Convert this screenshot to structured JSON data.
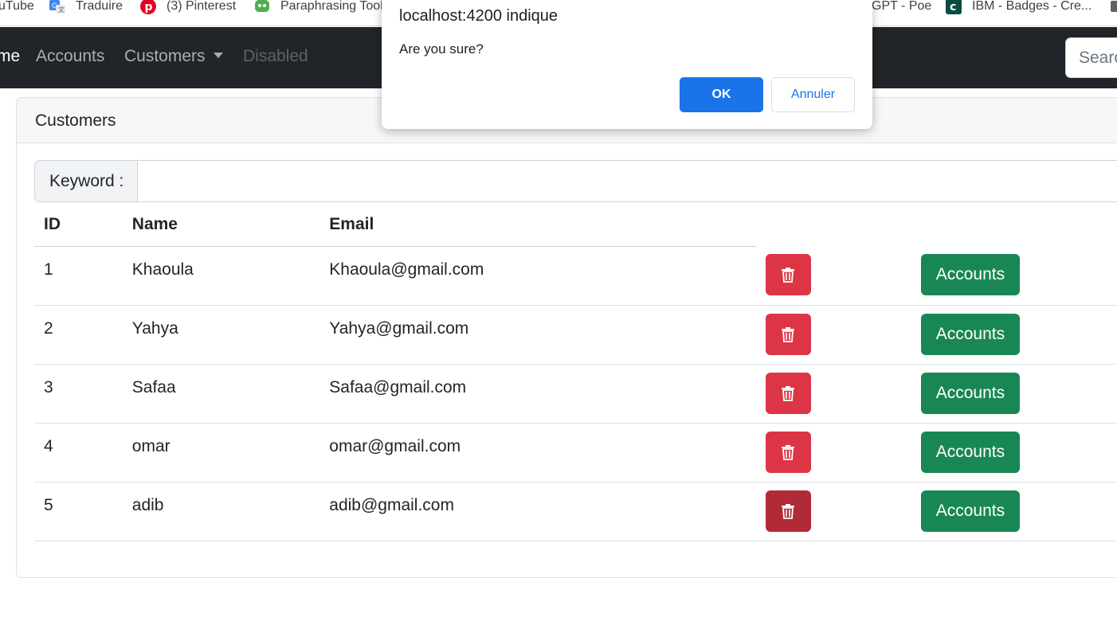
{
  "bookmarks": [
    {
      "label": "uTube",
      "icon": "youtube-icon"
    },
    {
      "label": "Traduire",
      "icon": "translate-icon"
    },
    {
      "label": "(3) Pinterest",
      "icon": "pinterest-icon"
    },
    {
      "label": "Paraphrasing Tool",
      "icon": "robot-icon"
    },
    {
      "label": "GPT - Poe",
      "icon": ""
    },
    {
      "label": "IBM - Badges - Cre...",
      "icon": "credly-icon"
    }
  ],
  "navbar": {
    "home": "me",
    "accounts": "Accounts",
    "customers": "Customers",
    "disabled": "Disabled",
    "search_placeholder": "Search"
  },
  "card": {
    "title": "Customers",
    "keyword_label": "Keyword :",
    "keyword_value": ""
  },
  "table": {
    "headers": [
      "ID",
      "Name",
      "Email"
    ],
    "accounts_label": "Accounts",
    "rows": [
      {
        "id": "1",
        "name": "Khaoula",
        "email": "Khaoula@gmail.com"
      },
      {
        "id": "2",
        "name": "Yahya",
        "email": "Yahya@gmail.com"
      },
      {
        "id": "3",
        "name": "Safaa",
        "email": "Safaa@gmail.com"
      },
      {
        "id": "4",
        "name": "omar",
        "email": "omar@gmail.com"
      },
      {
        "id": "5",
        "name": "adib",
        "email": "adib@gmail.com"
      }
    ]
  },
  "dialog": {
    "title": "localhost:4200 indique",
    "message": "Are you sure?",
    "ok": "OK",
    "cancel": "Annuler"
  },
  "colors": {
    "navbar": "#212529",
    "danger": "#dc3545",
    "danger_hover": "#b02a37",
    "success": "#198754",
    "dialog_primary": "#1a73e8"
  }
}
